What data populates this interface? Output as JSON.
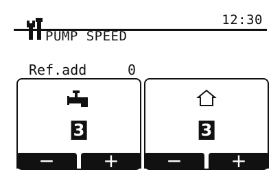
{
  "header": {
    "title": "PUMP SPEED",
    "time": "12:30",
    "icon": "wrench-icon"
  },
  "ref_add": {
    "label": "Ref.add",
    "value": "0"
  },
  "panels": [
    {
      "icon": "faucet-icon",
      "value": "3",
      "minus_label": "−",
      "plus_label": "+"
    },
    {
      "icon": "house-icon",
      "value": "3",
      "minus_label": "−",
      "plus_label": "+"
    }
  ]
}
